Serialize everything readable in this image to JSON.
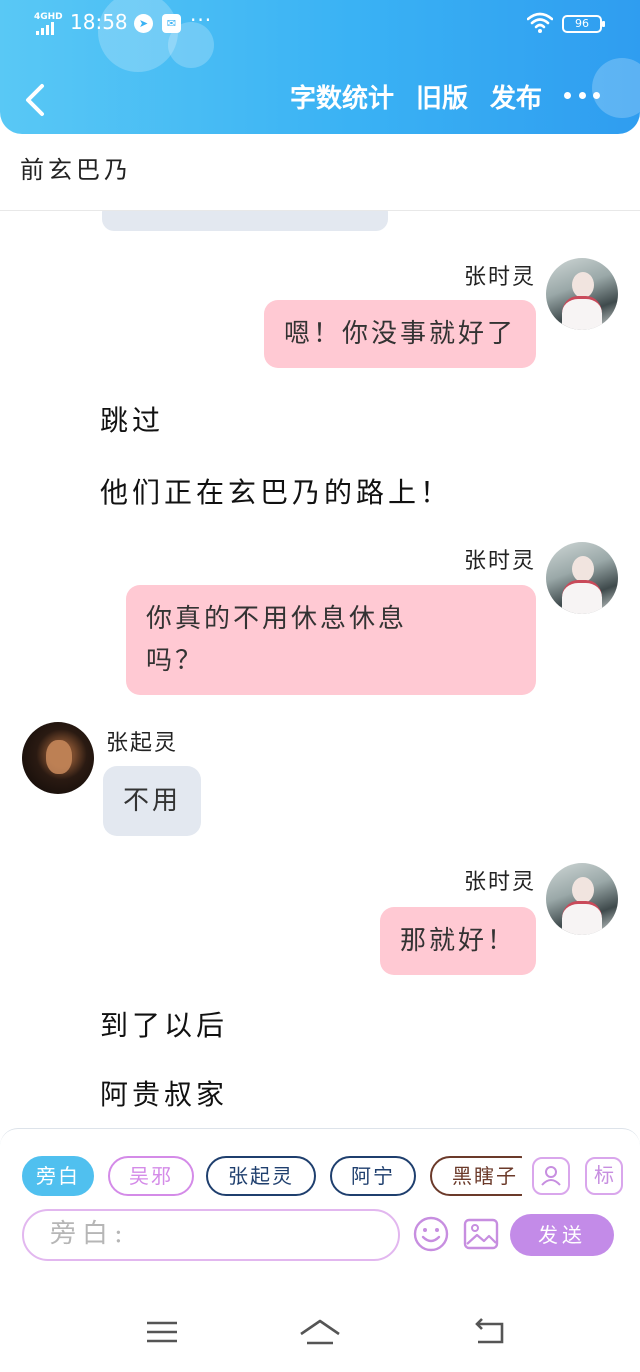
{
  "status_bar": {
    "network": "4GHD",
    "time": "18:58",
    "battery": "96",
    "extra_icons": [
      "compass-icon",
      "mail-icon"
    ]
  },
  "header": {
    "actions": [
      "字数统计",
      "旧版",
      "发布"
    ],
    "back_icon": "chevron-left-icon",
    "more_icon": "more-dots-icon",
    "gradient": [
      "#59c8f5",
      "#2f9df0"
    ]
  },
  "scene": {
    "title": "前玄巴乃"
  },
  "messages": [
    {
      "type": "bubble",
      "side": "right",
      "speaker": "张时灵",
      "text": "嗯！你没事就好了"
    },
    {
      "type": "narration",
      "text": "跳过"
    },
    {
      "type": "narration",
      "text": "他们正在玄巴乃的路上！"
    },
    {
      "type": "bubble",
      "side": "right",
      "speaker": "张时灵",
      "text_lines": [
        "你真的不用休息休息",
        "吗？"
      ]
    },
    {
      "type": "bubble",
      "side": "left",
      "speaker": "张起灵",
      "text": "不用"
    },
    {
      "type": "bubble",
      "side": "right",
      "speaker": "张时灵",
      "text": "那就好！"
    },
    {
      "type": "narration",
      "text": "到了以后"
    },
    {
      "type": "narration",
      "text": "阿贵叔家"
    }
  ],
  "composer": {
    "roles": [
      {
        "label": "旁白",
        "color": "#50c0ef",
        "active": true
      },
      {
        "label": "吴邪",
        "color": "#d48be8"
      },
      {
        "label": "张起灵",
        "color": "#1f3f6e"
      },
      {
        "label": "阿宁",
        "color": "#1f3f6e"
      },
      {
        "label": "黑瞎子",
        "color": "#6b3a2a"
      }
    ],
    "role_mark_label": "标",
    "input_placeholder": "旁白:",
    "send_label": "发送",
    "tool_icons": [
      "person-icon",
      "emoji-icon",
      "image-icon"
    ],
    "accent": "#c38be8"
  },
  "system_nav": [
    "menu-icon",
    "home-icon",
    "back-icon"
  ]
}
